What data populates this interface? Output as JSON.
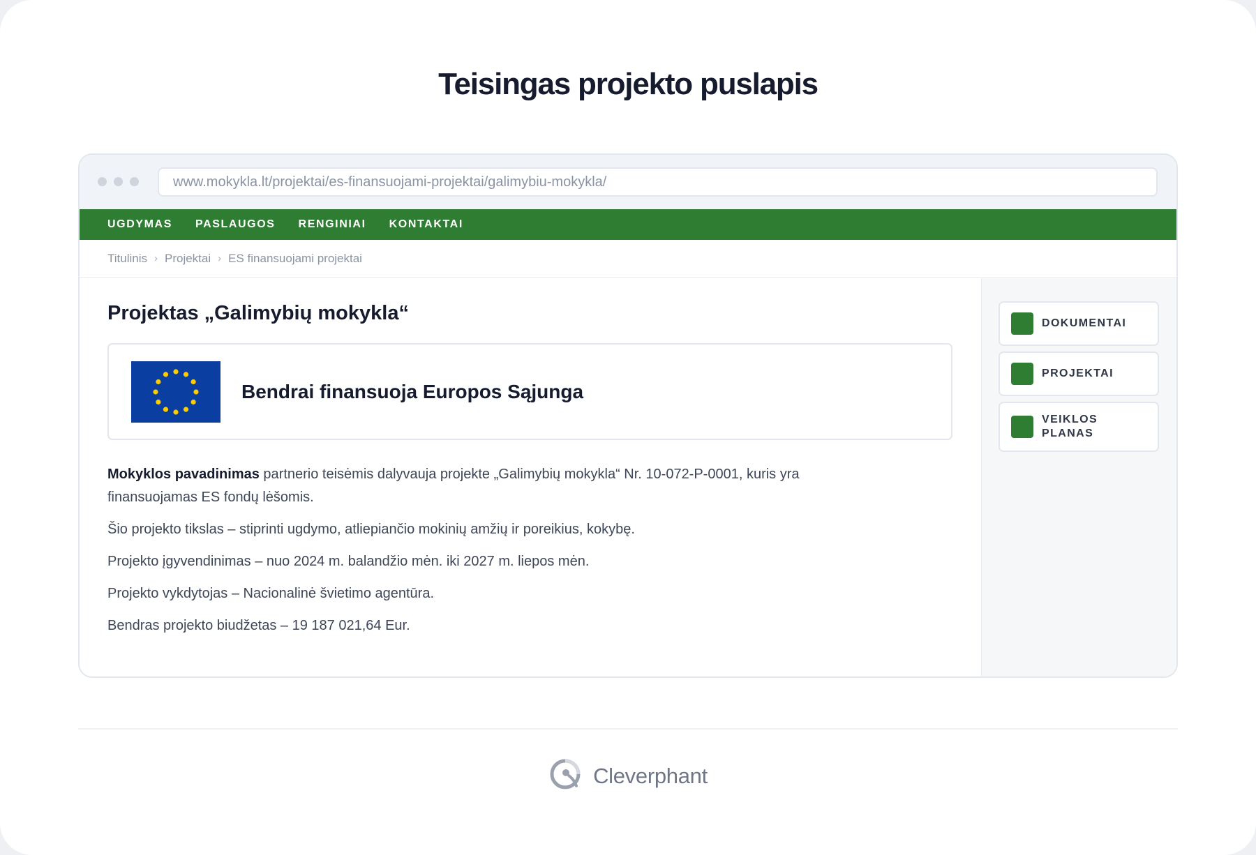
{
  "heading": "Teisingas projekto puslapis",
  "browser": {
    "url": "www.mokykla.lt/projektai/es-finansuojami-projektai/galimybiu-mokykla/"
  },
  "nav": {
    "items": [
      "UGDYMAS",
      "PASLAUGOS",
      "RENGINIAI",
      "KONTAKTAI"
    ],
    "bg_color": "#2e7d32"
  },
  "breadcrumb": [
    "Titulinis",
    "Projektai",
    "ES finansuojami projektai"
  ],
  "page": {
    "title": "Projektas „Galimybių mokykla“",
    "eu_banner": "Bendrai finansuoja Europos Sąjunga",
    "intro_bold": "Mokyklos pavadinimas",
    "intro_rest": " partnerio teisėmis dalyvauja projekte „Galimybių mokykla“ Nr. 10-072-P-0001, kuris yra finansuojamas ES fondų lėšomis.",
    "paragraphs": [
      "Šio projekto tikslas – stiprinti ugdymo, atliepiančio mokinių amžių ir poreikius, kokybę.",
      "Projekto įgyvendinimas – nuo 2024 m. balandžio mėn. iki 2027 m. liepos mėn.",
      "Projekto vykdytojas – Nacionalinė švietimo agentūra.",
      "Bendras projekto biudžetas – 19 187 021,64 Eur."
    ]
  },
  "sidebar": {
    "items": [
      {
        "line1": "DOKUMENTAI",
        "line2": ""
      },
      {
        "line1": "PROJEKTAI",
        "line2": ""
      },
      {
        "line1": "VEIKLOS",
        "line2": "PLANAS"
      }
    ]
  },
  "footer": {
    "brand": "Cleverphant",
    "icon": "cleverphant-logo-icon"
  },
  "colors": {
    "accent_green": "#2e7d32",
    "eu_blue": "#0a3ea0",
    "eu_star": "#ffcc00"
  }
}
